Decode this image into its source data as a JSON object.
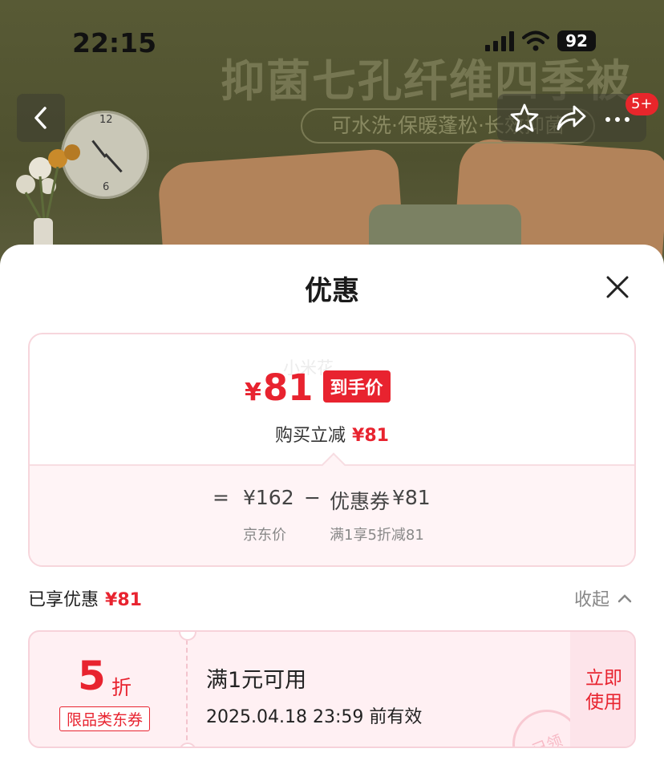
{
  "status_bar": {
    "time": "22:15",
    "battery": "92"
  },
  "banner": {
    "title": "抑菌七孔纤维四季被",
    "subtitle": "可水洗·保暖蓬松·长效抑菌",
    "cart_badge": "5+"
  },
  "sheet": {
    "title": "优惠",
    "watermark": "小米花",
    "final_price": {
      "currency": "¥",
      "amount": "81",
      "tag": "到手价"
    },
    "reduce": {
      "label": "购买立减",
      "value": "¥81"
    },
    "calc": {
      "eq": "=",
      "base": "¥162",
      "minus": "−",
      "coupon": "优惠券",
      "coupon_value": "¥81",
      "base_caption": "京东价",
      "coupon_caption": "满1享5折减81"
    },
    "enjoyed": {
      "label": "已享优惠",
      "value": "¥81"
    },
    "collapse_label": "收起",
    "coupon": {
      "discount": "5",
      "discount_unit": "折",
      "type": "限品类东券",
      "condition": "满1元可用",
      "validity": "2025.04.18 23:59 前有效",
      "stamp": "已领",
      "action": "立即使用"
    }
  },
  "colors": {
    "accent": "#e8232f",
    "coupon_bg": "#fff0f3",
    "banner_bg": "#585a35"
  }
}
